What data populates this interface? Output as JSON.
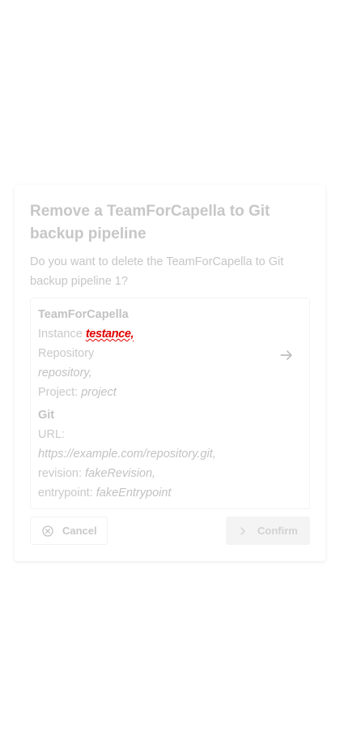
{
  "dialog": {
    "title": "Remove a TeamForCapella to Git backup pipeline",
    "message": "Do you want to delete the TeamForCapella to Git backup pipeline 1?"
  },
  "t4c": {
    "heading": "TeamForCapella",
    "instance_label": "Instance",
    "instance_value": "testance,",
    "repository_label": "Repository",
    "repository_value": "repository,",
    "project_label": "Project:",
    "project_value": "project"
  },
  "git": {
    "heading": "Git",
    "url_label": "URL:",
    "url_value": "https://example.com/repository.git,",
    "revision_label": "revision:",
    "revision_value": "fakeRevision,",
    "entrypoint_label": "entrypoint:",
    "entrypoint_value": "fakeEntrypoint"
  },
  "actions": {
    "cancel_label": "Cancel",
    "confirm_label": "Confirm"
  },
  "icons": {
    "arrow": "arrow-right-icon",
    "cancel": "cancel-circle-icon",
    "confirm": "chevron-right-icon"
  },
  "colors": {
    "spelling_error": "#e00000"
  }
}
